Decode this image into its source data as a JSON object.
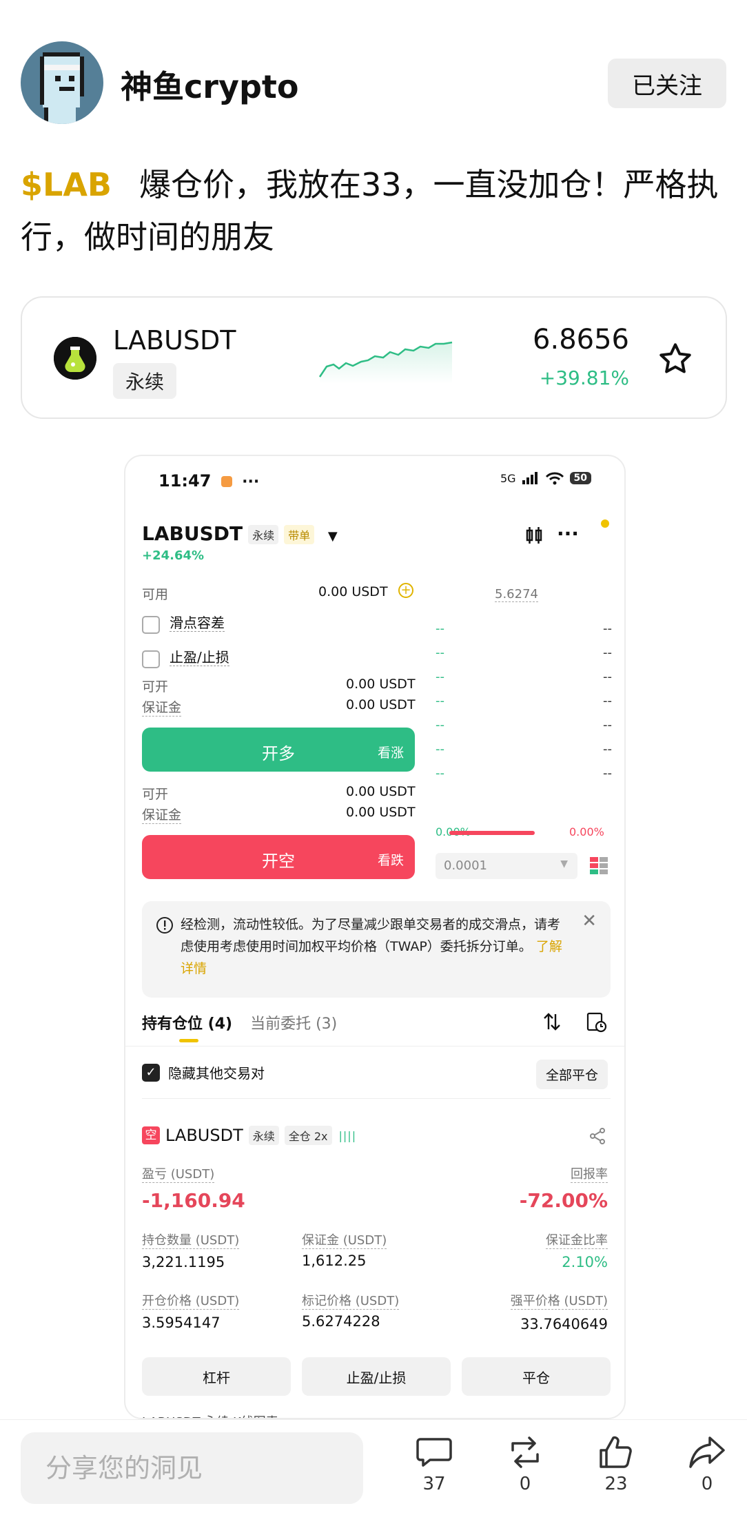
{
  "post": {
    "author": "神鱼crypto",
    "follow_label": "已关注",
    "ticker": "$LAB",
    "text": "爆仓价，我放在33，一直没加仓！严格执行，做时间的朋友"
  },
  "market_card": {
    "symbol": "LABUSDT",
    "tag": "永续",
    "price": "6.8656",
    "change": "+39.81%",
    "colors": {
      "up": "#2ebd85"
    }
  },
  "screenshot": {
    "status": {
      "time": "11:47",
      "network": "5G",
      "battery": "50"
    },
    "pair": "LABUSDT",
    "pair_tag": "永续",
    "order_tag": "带单",
    "pair_change": "+24.64%",
    "available_label": "可用",
    "available_value": "0.00 USDT",
    "orderbook_price": "5.6274",
    "slippage_label": "滑点容差",
    "tpsl_label": "止盈/止损",
    "long": {
      "open_label": "可开",
      "open_value": "0.00 USDT",
      "margin_label": "保证金",
      "margin_value": "0.00 USDT",
      "button": "开多",
      "sub": "看涨"
    },
    "short": {
      "open_label": "可开",
      "open_value": "0.00 USDT",
      "margin_label": "保证金",
      "margin_value": "0.00 USDT",
      "button": "开空",
      "sub": "看跌"
    },
    "orderbook_placeholder": "--",
    "ratio_left": "0.00%",
    "ratio_right": "0.00%",
    "qty_step": "0.0001",
    "notice": {
      "text": "经检测，流动性较低。为了尽量减少跟单交易者的成交滑点，请考虑使用考虑使用时间加权平均价格（TWAP）委托拆分订单。",
      "link": "了解详情"
    },
    "tabs": {
      "positions": "持有仓位 (4)",
      "orders": "当前委托 (3)"
    },
    "hide_others": "隐藏其他交易对",
    "close_all": "全部平仓",
    "position": {
      "side_badge": "空",
      "symbol": "LABUSDT",
      "tag": "永续",
      "mode": "全仓 2x",
      "pnl_label": "盈亏 (USDT)",
      "pnl": "-1,160.94",
      "roe_label": "回报率",
      "roe": "-72.00%",
      "size_label": "持仓数量 (USDT)",
      "size": "3,221.1195",
      "margin_label": "保证金 (USDT)",
      "margin": "1,612.25",
      "margin_ratio_label": "保证金比率",
      "margin_ratio": "2.10%",
      "entry_label": "开仓价格 (USDT)",
      "entry": "3.5954147",
      "mark_label": "标记价格 (USDT)",
      "mark": "5.6274228",
      "liq_label": "强平价格 (USDT)",
      "liq": "33.7640649",
      "btn_leverage": "杠杆",
      "btn_tpsl": "止盈/止损",
      "btn_close": "平仓"
    },
    "bottom_peek": "LABUSDT 永续 K线图表"
  },
  "bottom_bar": {
    "placeholder": "分享您的洞见",
    "comments": "37",
    "reposts": "0",
    "likes": "23",
    "shares": "0"
  }
}
